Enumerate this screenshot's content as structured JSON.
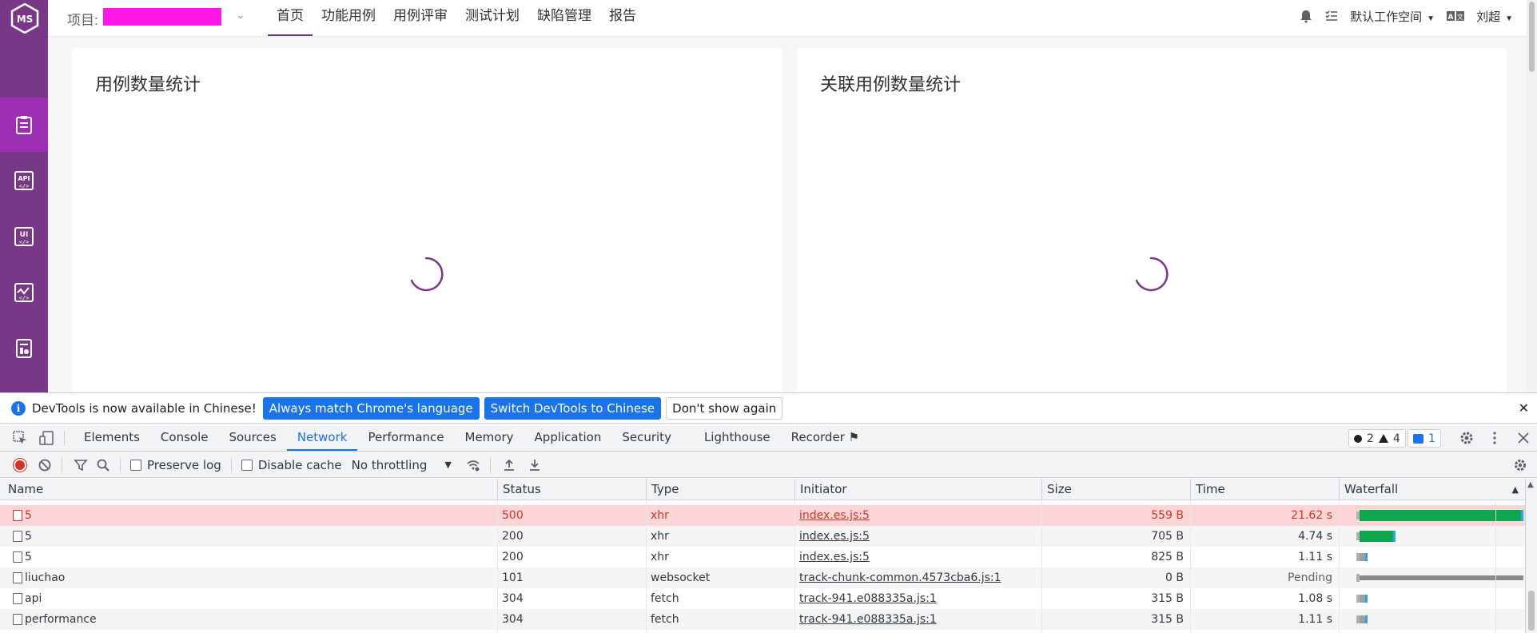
{
  "header": {
    "project_label": "项目:",
    "nav": [
      "首页",
      "功能用例",
      "用例评审",
      "测试计划",
      "缺陷管理",
      "报告"
    ],
    "workspace": "默认工作空间",
    "user": "刘超"
  },
  "cards": {
    "left_title": "用例数量统计",
    "right_title": "关联用例数量统计"
  },
  "colors": {
    "brand": "#783887",
    "brand_active": "#9c2fb4",
    "devtools_blue": "#1a73e8",
    "error_red": "#d93025"
  },
  "devtools": {
    "infobar": {
      "text": "DevTools is now available in Chinese!",
      "btn_match": "Always match Chrome's language",
      "btn_switch": "Switch DevTools to Chinese",
      "btn_dismiss": "Don't show again",
      "close": "✕"
    },
    "tabs": [
      "Elements",
      "Console",
      "Sources",
      "Network",
      "Performance",
      "Memory",
      "Application",
      "Security",
      "Lighthouse",
      "Recorder"
    ],
    "badges": {
      "errors": "2",
      "warnings": "4",
      "messages": "1"
    },
    "network_toolbar": {
      "preserve_log": "Preserve log",
      "disable_cache": "Disable cache",
      "throttling": "No throttling"
    },
    "columns": [
      "Name",
      "Status",
      "Type",
      "Initiator",
      "Size",
      "Time",
      "Waterfall"
    ],
    "rows": [
      {
        "name": "5",
        "status": "500",
        "type": "xhr",
        "initiator": "index.es.js:5",
        "size": "559 B",
        "time": "21.62 s",
        "error": true,
        "wf_fraction": 1.0
      },
      {
        "name": "5",
        "status": "200",
        "type": "xhr",
        "initiator": "index.es.js:5",
        "size": "705 B",
        "time": "4.74 s",
        "error": false,
        "wf_fraction": 0.22
      },
      {
        "name": "5",
        "status": "200",
        "type": "xhr",
        "initiator": "index.es.js:5",
        "size": "825 B",
        "time": "1.11 s",
        "error": false,
        "wf_fraction": 0.05
      },
      {
        "name": "liuchao",
        "status": "101",
        "type": "websocket",
        "initiator": "track-chunk-common.4573cba6.js:1",
        "size": "0 B",
        "time": "Pending",
        "error": false,
        "wf_fraction": 1.0,
        "pending": true
      },
      {
        "name": "api",
        "status": "304",
        "type": "fetch",
        "initiator": "track-941.e088335a.js:1",
        "size": "315 B",
        "time": "1.08 s",
        "error": false,
        "wf_fraction": 0.05
      },
      {
        "name": "performance",
        "status": "304",
        "type": "fetch",
        "initiator": "track-941.e088335a.js:1",
        "size": "315 B",
        "time": "1.11 s",
        "error": false,
        "wf_fraction": 0.05
      }
    ]
  }
}
